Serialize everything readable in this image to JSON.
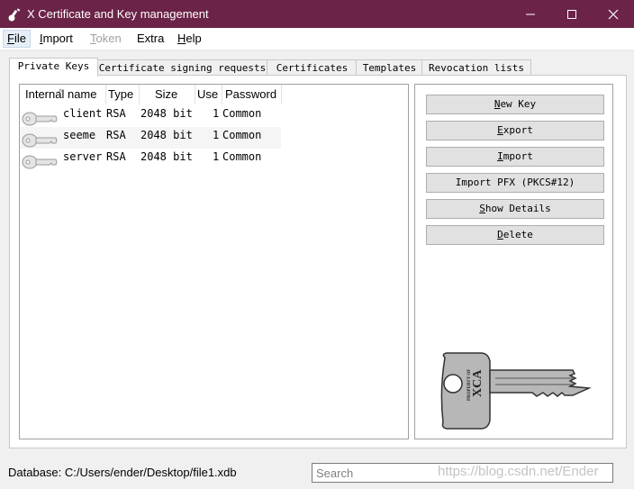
{
  "window": {
    "title": "X Certificate and Key management",
    "title_bar_color": "#6b2347"
  },
  "menu": {
    "items": [
      {
        "label": "File",
        "underline": "F",
        "active": true
      },
      {
        "label": "Import",
        "underline": "I"
      },
      {
        "label": "Token",
        "underline": "T",
        "disabled": true
      },
      {
        "label": "Extra"
      },
      {
        "label": "Help",
        "underline": "H"
      }
    ]
  },
  "tabs": [
    {
      "label": "Private Keys",
      "active": true
    },
    {
      "label": "Certificate signing requests"
    },
    {
      "label": "Certificates"
    },
    {
      "label": "Templates"
    },
    {
      "label": "Revocation lists"
    }
  ],
  "key_table": {
    "columns": [
      "Internal name",
      "Type",
      "Size",
      "Use",
      "Password"
    ],
    "rows": [
      {
        "name": "client",
        "type": "RSA",
        "size": "2048 bit",
        "use": "1",
        "password": "Common"
      },
      {
        "name": "seeme",
        "type": "RSA",
        "size": "2048 bit",
        "use": "1",
        "password": "Common"
      },
      {
        "name": "server",
        "type": "RSA",
        "size": "2048 bit",
        "use": "1",
        "password": "Common"
      }
    ]
  },
  "actions": [
    {
      "label": "New Key"
    },
    {
      "label": "Export"
    },
    {
      "label": "Import"
    },
    {
      "label": "Import PFX (PKCS#12)"
    },
    {
      "label": "Show Details"
    },
    {
      "label": "Delete"
    }
  ],
  "key_image": {
    "top_text": "PROPERTY OF",
    "brand": "XCA"
  },
  "status": {
    "database": "Database: C:/Users/ender/Desktop/file1.xdb"
  },
  "search": {
    "placeholder": "Search",
    "value": ""
  },
  "watermark": "https://blog.csdn.net/Ender"
}
